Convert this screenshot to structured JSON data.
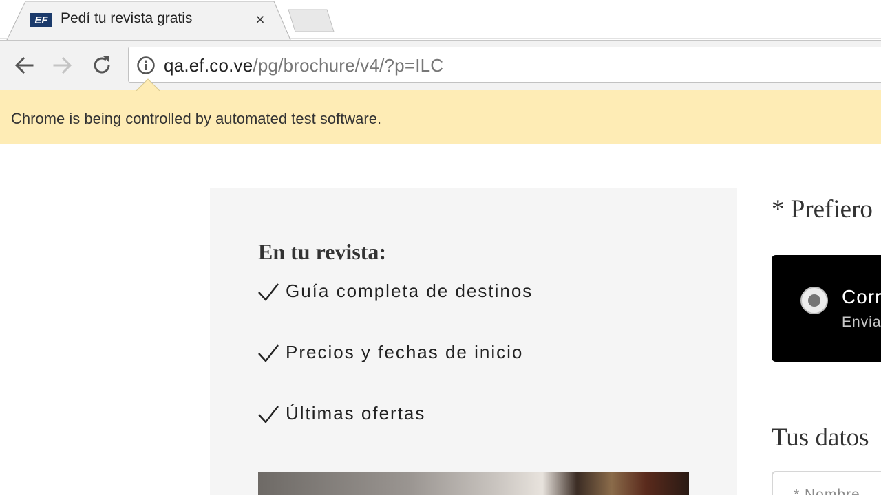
{
  "browser": {
    "tab": {
      "favicon": "ef-logo-icon",
      "favicon_text": "EF",
      "title": "Pedí tu revista gratis",
      "close_glyph": "×"
    },
    "toolbar": {
      "back_icon": "back-arrow-icon",
      "forward_icon": "forward-arrow-icon",
      "reload_icon": "reload-icon",
      "info_icon": "info-icon",
      "url_host": "qa.ef.co.ve",
      "url_path": "/pg/brochure/v4/?p=ILC"
    },
    "infobar": {
      "message": "Chrome is being controlled by automated test software."
    }
  },
  "page": {
    "benefits": {
      "title": "En tu revista:",
      "items": [
        "Guía completa de destinos",
        "Precios y fechas de inicio",
        "Últimas ofertas"
      ]
    },
    "preference": {
      "label": "* Prefiero",
      "option": {
        "title": "Corr",
        "subtitle": "Envia",
        "selected": true
      }
    },
    "details": {
      "heading": "Tus datos",
      "name_placeholder": "* Nombre"
    }
  },
  "colors": {
    "infobar_bg": "#feecb5",
    "panel_bg": "#f5f5f5",
    "option_card_bg": "#000000",
    "brand_orange": "#e9531f"
  }
}
